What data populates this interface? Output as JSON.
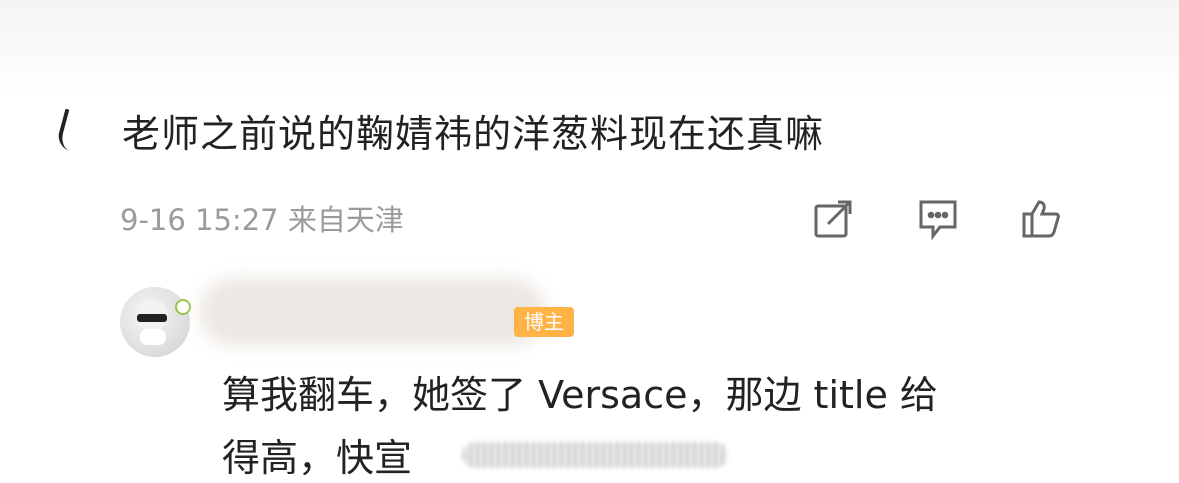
{
  "comment": {
    "text": "老师之前说的鞠婧祎的洋葱料现在还真嘛",
    "meta": "9-16 15:27 来自天津"
  },
  "actions": {
    "icons": [
      "share-icon",
      "comment-icon",
      "like-icon"
    ]
  },
  "reply": {
    "badge": "博主",
    "line1": "算我翻车，她签了 Versace，那边 title 给",
    "line2": "得高，快宣"
  }
}
